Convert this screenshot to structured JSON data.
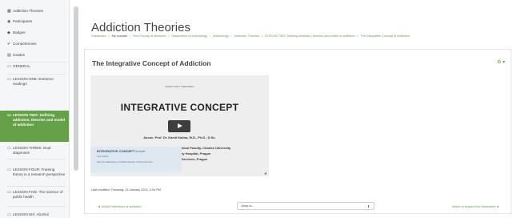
{
  "sidebar": {
    "items": [
      {
        "icon": "calendar-grid-icon",
        "glyph": "▦",
        "label": "Addiction Theories"
      },
      {
        "icon": "users-icon",
        "glyph": "◉",
        "label": "Participants"
      },
      {
        "icon": "badge-icon",
        "glyph": "◆",
        "label": "Badges"
      },
      {
        "icon": "competencies-icon",
        "glyph": "✔",
        "label": "Competencies"
      },
      {
        "icon": "grades-icon",
        "glyph": "▤",
        "label": "Grades"
      },
      {
        "icon": "folder-icon",
        "glyph": "▭",
        "label": "GENERAL"
      },
      {
        "icon": "folder-icon",
        "glyph": "▭",
        "label": "LESSON ONE: Entrance readings"
      },
      {
        "icon": "folder-icon",
        "glyph": "▭",
        "label": "LESSON TWO: Defining addiction, theories and model of addiction"
      },
      {
        "icon": "folder-icon",
        "glyph": "▭",
        "label": "LESSON THREE: Dual diagnoses"
      },
      {
        "icon": "folder-icon",
        "glyph": "▭",
        "label": "LESSON FOUR: Framing theory in a research perspective"
      },
      {
        "icon": "folder-icon",
        "glyph": "▭",
        "label": "LESSON FIVE: The science of public health"
      },
      {
        "icon": "folder-icon",
        "glyph": "▭",
        "label": "LESSON SIX: Alcohol"
      }
    ]
  },
  "header": {
    "course_title": "Addiction Theories",
    "breadcrumb": [
      "Dashboard",
      "My courses",
      "First Faculty of Medicine",
      "Department of Addictology",
      "Addictology",
      "Addiction Theories",
      "LESSON TWO: Defining addiction, theories and model of addiction",
      "The Integrative Concept of Addiction"
    ]
  },
  "activity": {
    "title": "The Integrative Concept of Addiction",
    "gear_label": "⚙ ▾",
    "video": {
      "slide_tag": "ADDICTION THEORIES",
      "slide_title": "INTEGRATIVE CONCEPT",
      "author": "Assoc. Prof. Dr. Kamil Kalina, M.D., Ph.D., D.Sc.",
      "affiliation_lines": [
        "dical Faculty, Charles University",
        "ty Hospital, Prague",
        "Services, Prague"
      ],
      "lecture_title": "INTEGRATIVE CONCEPT",
      "lecture_suffix": "lecture",
      "lecture_name": "Kamil Kalina",
      "lecture_dept": "Dept. for Addictology, 1st Medical Faculty, Charles University"
    },
    "last_modified": "Last modified: Thursday, 13 January 2022, 1:04 PM"
  },
  "footer_nav": {
    "prev_label": "◄ ASAM Definitions of addiction",
    "jump_placeholder": "Jump to...",
    "next_label": "Watch to expand the information ►"
  },
  "colors": {
    "accent": "#64a047",
    "sidebar_bg": "#f5f6f7",
    "text": "#444444"
  }
}
